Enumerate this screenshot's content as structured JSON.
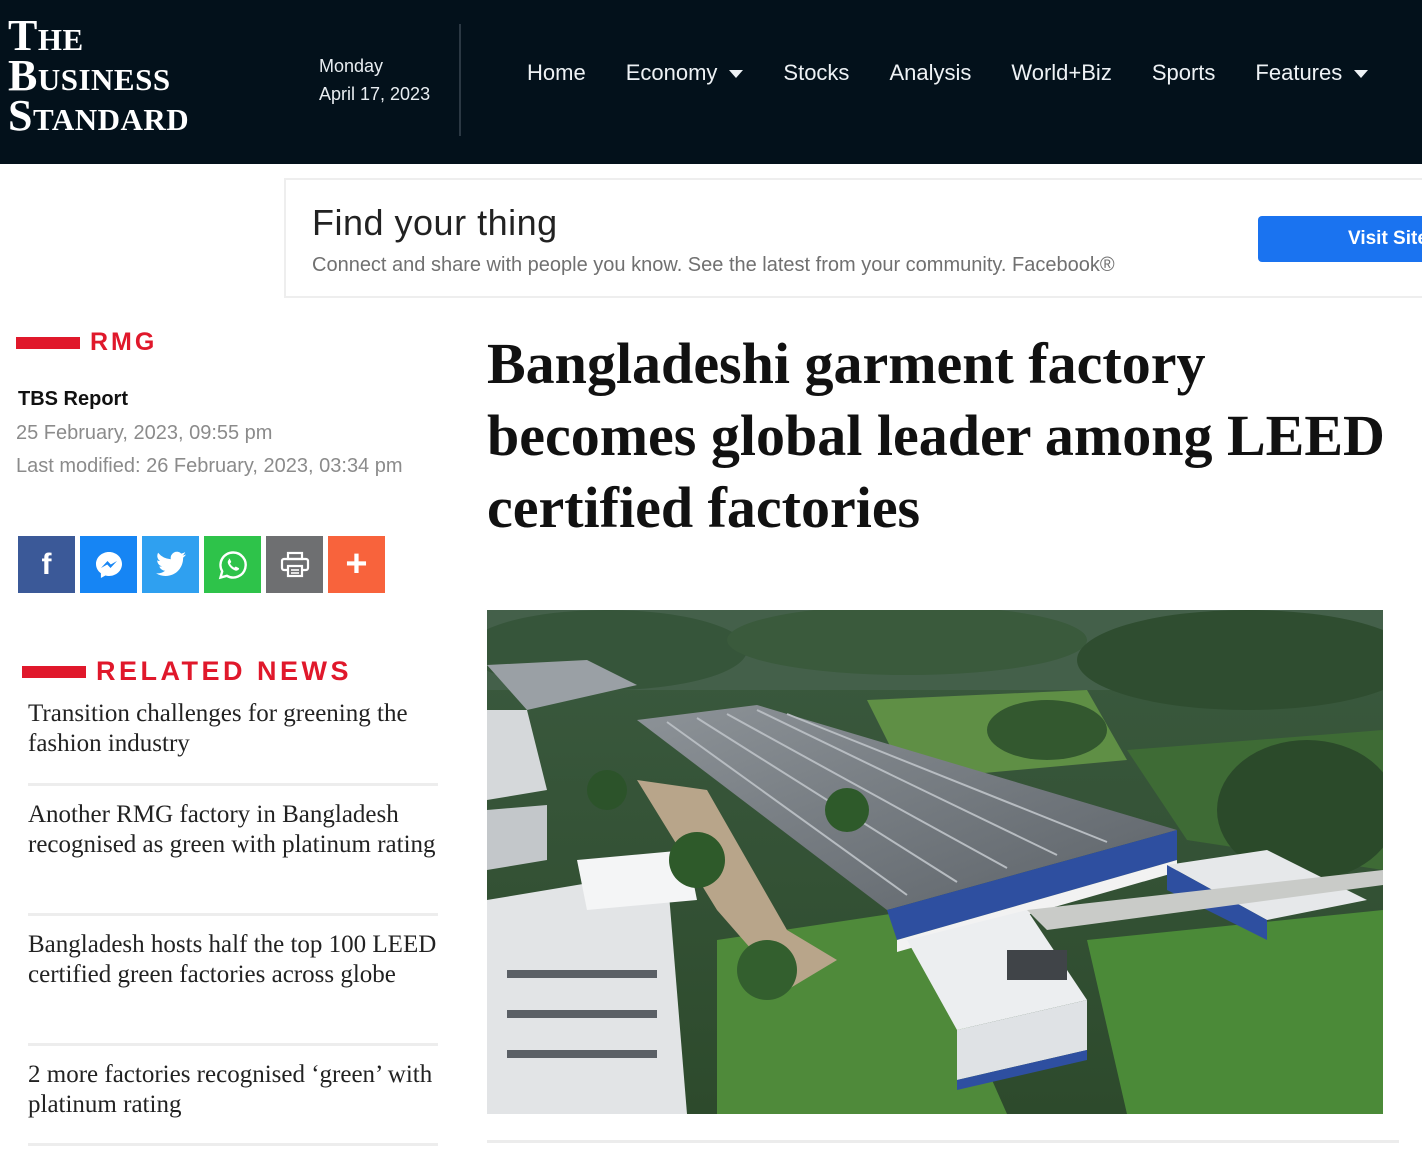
{
  "header": {
    "logo_lines": [
      "The",
      "Business",
      "Standard"
    ],
    "day": "Monday",
    "date": "April 17, 2023",
    "nav": [
      {
        "label": "Home",
        "dropdown": false
      },
      {
        "label": "Economy",
        "dropdown": true
      },
      {
        "label": "Stocks",
        "dropdown": false
      },
      {
        "label": "Analysis",
        "dropdown": false
      },
      {
        "label": "World+Biz",
        "dropdown": false
      },
      {
        "label": "Sports",
        "dropdown": false
      },
      {
        "label": "Features",
        "dropdown": true
      }
    ]
  },
  "ad": {
    "title": "Find your thing",
    "text": "Connect and share with people you know. See the latest from your community. Facebook®",
    "button": "Visit Site"
  },
  "article": {
    "section": "RMG",
    "author": "TBS Report",
    "published": "25 February, 2023, 09:55 pm",
    "modified": "Last modified: 26 February, 2023, 03:34 pm",
    "headline": "Bangladeshi garment factory becomes global leader among LEED certified factories"
  },
  "share": {
    "icons": [
      "facebook-icon",
      "messenger-icon",
      "twitter-icon",
      "whatsapp-icon",
      "print-icon",
      "plus-icon"
    ],
    "colors": {
      "facebook": "#3b5998",
      "messenger": "#1685f4",
      "twitter": "#2fa0f0",
      "whatsapp": "#2ec34a",
      "print": "#6e6f71",
      "more": "#f8633c"
    }
  },
  "related": {
    "title": "RELATED NEWS",
    "items": [
      "Transition challenges for greening the fashion industry",
      "Another RMG factory in Bangladesh recognised as green with platinum rating",
      "Bangladesh hosts half the top 100 LEED certified green factories across globe",
      "2 more factories recognised ‘green’ with platinum rating"
    ]
  },
  "theme": {
    "accent": "#e0182b",
    "header_bg": "#03111b",
    "ad_button": "#1a73f0"
  }
}
